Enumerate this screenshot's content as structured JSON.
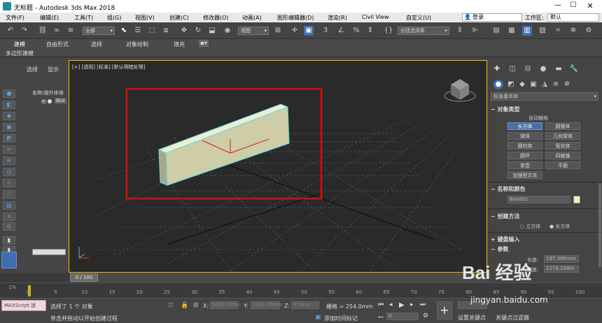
{
  "window": {
    "title": "无标题 - Autodesk 3ds Max 2018"
  },
  "menu": {
    "items": [
      "文件(F)",
      "编辑(E)",
      "工具(T)",
      "组(G)",
      "视图(V)",
      "创建(C)",
      "修改器(O)",
      "动画(A)",
      "图形编辑器(D)",
      "渲染(R)",
      "Civil View",
      "自定义(U)"
    ],
    "login": "登录",
    "workspace_label": "工作区:",
    "workspace_value": "默认"
  },
  "toolbar": {
    "selection_filter": "全部",
    "ref_coord": "视图",
    "named_sel": "创建选择集"
  },
  "ribbon": {
    "tabs": [
      "建模",
      "自由形式",
      "选择",
      "对象绘制",
      "填充"
    ],
    "sub": "多边形建模"
  },
  "scene": {
    "tabs": [
      "选择",
      "显示"
    ],
    "column": "名称(按升序排",
    "item": "Box"
  },
  "viewport": {
    "label": "[+] [透视] [标准] [默认明暗处理]"
  },
  "cmd": {
    "dropdown": "标准基本体",
    "object_type": {
      "header": "对象类型",
      "autogrid": "自动栅格",
      "buttons": [
        "长方体",
        "圆锥体",
        "球体",
        "几何球体",
        "圆柱体",
        "管状体",
        "圆环",
        "四棱锥",
        "茶壶",
        "平面",
        "加强型文本"
      ]
    },
    "name_color": {
      "header": "名称和颜色",
      "name": "Box001",
      "swatch": "#f3efc8"
    },
    "creation": {
      "header": "创建方法",
      "opt1": "立方体",
      "opt2": "长方体"
    },
    "keyboard": {
      "header": "键盘输入"
    },
    "params": {
      "header": "参数",
      "length_label": "长度:",
      "length_value": "197.398mm",
      "width_label": "宽度:",
      "width_value": "2278.208m"
    }
  },
  "timeline": {
    "frame_display": "0 / 100",
    "ticks": [
      "0",
      "5",
      "10",
      "15",
      "20",
      "25",
      "30",
      "35",
      "40",
      "45",
      "50",
      "55",
      "60",
      "65",
      "70",
      "75",
      "80",
      "85",
      "90",
      "95",
      "100"
    ],
    "trackbar_label": "1%"
  },
  "status": {
    "script": "MAXScript 迷",
    "selected": "选择了 1 个 对象",
    "prompt": "单击并拖动以开始创建过程",
    "x_label": "X:",
    "x_value": "5625.015m",
    "y_label": "Y:",
    "y_value": "1502.45mm",
    "z_label": "Z:",
    "z_value": "0.0mm",
    "grid": "栅格 = 254.0mm",
    "add_time_tag": "添加时间标记",
    "set_key": "设置关键点",
    "key_filter": "关键点过滤器",
    "frame": "0"
  },
  "watermark": {
    "brand": "Bai 经验",
    "url": "jingyan.baidu.com"
  }
}
